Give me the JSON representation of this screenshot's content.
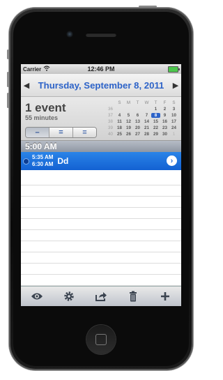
{
  "status_bar": {
    "carrier": "Carrier",
    "time": "12:46 PM"
  },
  "date_nav": {
    "title": "Thursday, September 8, 2011"
  },
  "summary": {
    "event_count": "1 event",
    "duration": "55 minutes"
  },
  "segments": [
    "–",
    "=",
    "≡"
  ],
  "mini_calendar": {
    "weekdays": [
      "S",
      "M",
      "T",
      "W",
      "T",
      "F",
      "S"
    ],
    "weeks": [
      {
        "wk": "36",
        "days": [
          "",
          "",
          "",
          "",
          "1",
          "2",
          "3"
        ]
      },
      {
        "wk": "37",
        "days": [
          "4",
          "5",
          "6",
          "7",
          "8",
          "9",
          "10"
        ]
      },
      {
        "wk": "38",
        "days": [
          "11",
          "12",
          "13",
          "14",
          "15",
          "16",
          "17"
        ]
      },
      {
        "wk": "39",
        "days": [
          "18",
          "19",
          "20",
          "21",
          "22",
          "23",
          "24"
        ]
      },
      {
        "wk": "40",
        "days": [
          "25",
          "26",
          "27",
          "28",
          "29",
          "30",
          "1"
        ]
      }
    ],
    "selected_day": "8"
  },
  "hour_header": "5:00 AM",
  "event": {
    "start": "5:35 AM",
    "end": "6:30 AM",
    "title": "Dd"
  },
  "toolbar_icons": [
    "eye-icon",
    "gear-icon",
    "share-icon",
    "trash-icon",
    "add-icon"
  ],
  "colors": {
    "accent": "#2d63c8",
    "event": "#1f74e0"
  }
}
